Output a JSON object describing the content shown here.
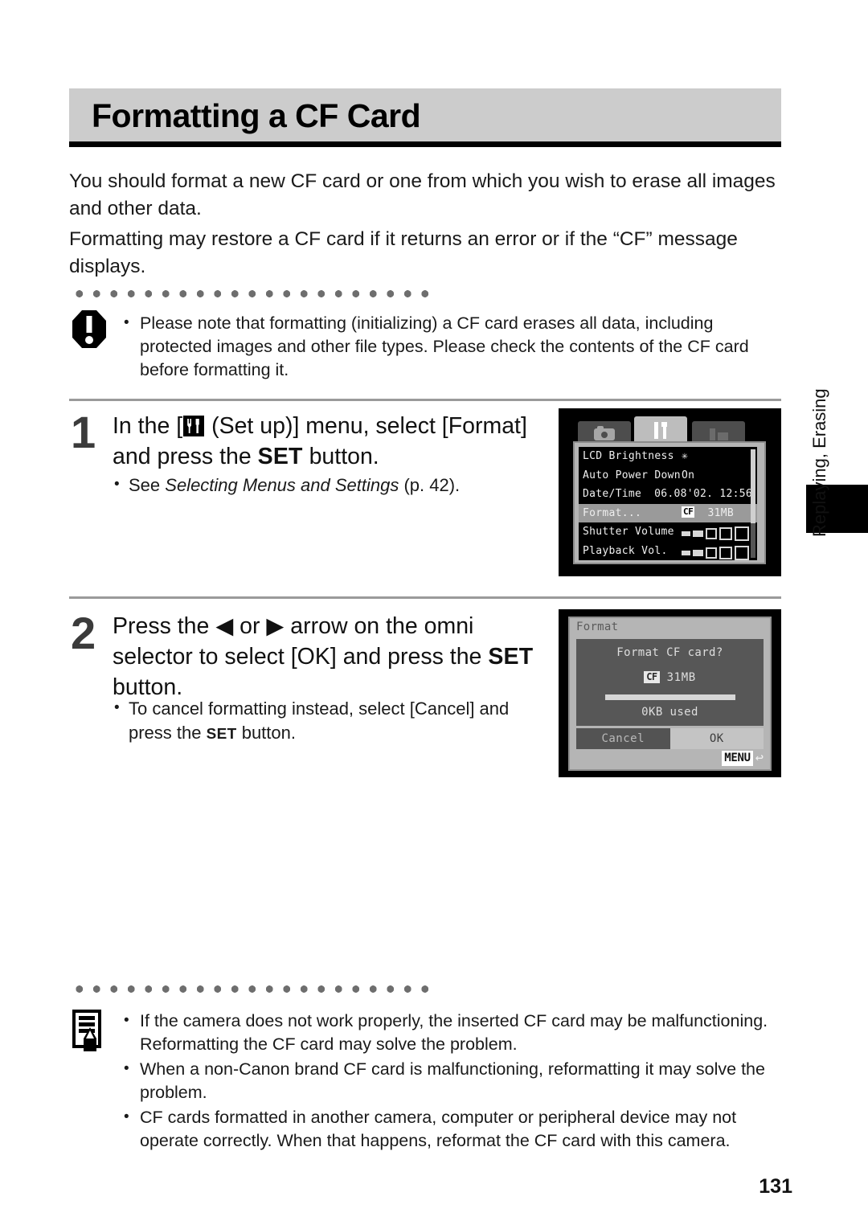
{
  "page": {
    "title": "Formatting a CF Card",
    "number": "131",
    "side_tab_label": "Replaying, Erasing"
  },
  "intro": {
    "paragraph_1": "You should format a new CF card or one from which you wish to erase all images and other data.",
    "paragraph_2": "Formatting may restore a CF card if it returns an error or if the “CF” message displays."
  },
  "warning": {
    "icon": "exclamation-octagon-icon",
    "items": [
      "Please note that formatting (initializing) a CF card erases all data, including protected images and other file types. Please check the contents of the CF card before formatting it."
    ]
  },
  "steps": [
    {
      "number": "1",
      "head_before_icon": "In the [",
      "icon": "setup-tools-icon",
      "head_after_icon": " (Set up)] menu, select [Format] and press the ",
      "set_key": "SET",
      "head_tail": " button.",
      "sub_prefix": "See ",
      "sub_italic": "Selecting Menus and Settings",
      "sub_suffix": " (p. 42)."
    },
    {
      "number": "2",
      "head_1": "Press the ",
      "arrow_left": "◀",
      "head_2": " or ",
      "arrow_right": "▶",
      "head_3": " arrow on the omni selector to select [OK] and press the ",
      "set_key": "SET",
      "head_tail": " button.",
      "sub_1": "To cancel formatting instead, select [Cancel] and press the ",
      "sub_set_key": "SET",
      "sub_2": " button."
    }
  ],
  "lcd_setup_menu": {
    "tabs": [
      {
        "name": "camera-tab",
        "icon": "camera-icon",
        "active": false
      },
      {
        "name": "setup-tab",
        "icon": "tools-icon",
        "active": true
      },
      {
        "name": "playback-tab",
        "icon": "play-setup-icon",
        "active": false
      }
    ],
    "rows": [
      {
        "label": "LCD Brightness",
        "value": "✳",
        "type": "value-mid",
        "selected": false
      },
      {
        "label": "Auto Power Down",
        "value": "On",
        "type": "value-mid",
        "selected": false
      },
      {
        "label": "Date/Time",
        "value": "06.08'02. 12:56",
        "type": "value-right",
        "selected": false
      },
      {
        "label": "Format...",
        "chip": "CF",
        "value": "31MB",
        "type": "card",
        "selected": true
      },
      {
        "label": "Shutter Volume",
        "value": "",
        "type": "volume",
        "selected": false
      },
      {
        "label": "Playback Vol.",
        "value": "",
        "type": "volume",
        "selected": false
      }
    ]
  },
  "lcd_format_dialog": {
    "title": "Format",
    "question": "Format CF card?",
    "card_chip": "CF",
    "card_size": "31MB",
    "used": "0KB used",
    "buttons": [
      {
        "label": "Cancel",
        "selected": false
      },
      {
        "label": "OK",
        "selected": true
      }
    ],
    "menu_hint": "MENU",
    "return_glyph": "↩"
  },
  "notes": {
    "icon": "memo-pencil-icon",
    "items": [
      "If the camera does not work properly, the inserted CF card may be malfunctioning. Reformatting the CF card may solve the problem.",
      "When a non-Canon brand CF card is malfunctioning, reformatting it may solve the problem.",
      "CF cards formatted in another camera, computer or peripheral device may not operate correctly. When that happens, reformat the CF card with this camera."
    ]
  },
  "colors": {
    "title_band": "#cccccc",
    "rule": "#000000",
    "step_rule": "#9a9a9a",
    "step_number": "#3b3b3b"
  }
}
